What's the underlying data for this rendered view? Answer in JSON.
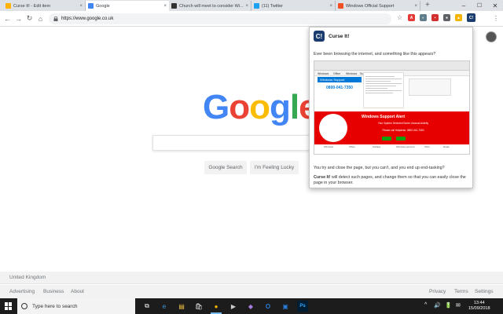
{
  "tabs": [
    {
      "title": "Curse It! - Edit item",
      "favicon_color": "#ffb300"
    },
    {
      "title": "Google",
      "favicon_color": "#4285f4",
      "active": true
    },
    {
      "title": "Church will meet to consider Wi...",
      "favicon_color": "#333333"
    },
    {
      "title": "(11) Twitter",
      "favicon_color": "#1da1f2"
    },
    {
      "title": "Windows Official Support",
      "favicon_color": "#f25022"
    }
  ],
  "tab_close_glyph": "×",
  "new_tab_glyph": "+",
  "window_controls": {
    "minimize": "–",
    "maximize": "☐",
    "close": "✕"
  },
  "toolbar": {
    "back": "←",
    "forward": "→",
    "reload": "↻",
    "home": "⌂",
    "url": "https://www.google.co.uk",
    "star": "☆",
    "extensions": [
      {
        "label": "A",
        "color": "#e53935"
      },
      {
        "label": "◐",
        "color": "#607d8b"
      },
      {
        "label": "▪",
        "color": "#d32f2f"
      },
      {
        "label": "●",
        "color": "#5f6368"
      },
      {
        "label": "▲",
        "color": "#f4b400"
      },
      {
        "label": "C!",
        "color": "#1a3c6e"
      }
    ],
    "menu": "⋮"
  },
  "google": {
    "logo_letters": [
      {
        "ch": "G",
        "color": "#4285f4"
      },
      {
        "ch": "o",
        "color": "#ea4335"
      },
      {
        "ch": "o",
        "color": "#fbbc05"
      },
      {
        "ch": "g",
        "color": "#4285f4"
      },
      {
        "ch": "l",
        "color": "#34a853"
      },
      {
        "ch": "e",
        "color": "#ea4335"
      }
    ],
    "search_button": "Google Search",
    "lucky_button": "I'm Feeling Lucky",
    "country": "United Kingdom",
    "footer_left": [
      "Advertising",
      "Business",
      "About"
    ],
    "footer_right": [
      "Privacy",
      "Terms",
      "Settings"
    ]
  },
  "popup": {
    "badge": "C!",
    "title": "Curse It!",
    "intro": "Ever been browsing the internet, and something like this appears?",
    "para1": "You try and close the page, but you can't, and you end up end-tasking?",
    "para2_bold": "Curse It!",
    "para2_rest": " will detect such pages, and change them so that you can easily close the page in your browser.",
    "shot": {
      "nav_items": [
        "Windows",
        "Office",
        "Windows",
        "Surface",
        "Xbox",
        "Deals"
      ],
      "bar_label": "Windows Support",
      "phone": "0800-041-7350",
      "alert_title": "Windows Support Alert",
      "alert_sub1": "Your System Detected Some Unusual Activity",
      "alert_sub2": "Please call Helpdesk: 0800-041-7350",
      "footer_items": [
        "Windows",
        "Office",
        "Surface",
        "Windows account",
        "Xbox",
        "Deals"
      ]
    }
  },
  "taskbar": {
    "search_placeholder": "Type here to search",
    "apps": [
      "⧉",
      "e",
      "▤",
      "🛍",
      "●",
      "▶",
      "◆",
      "O",
      "▣",
      "Ps"
    ],
    "tray": [
      "^",
      "🔊",
      "🔋",
      "✉"
    ],
    "time": "13:44",
    "date": "15/09/2018"
  }
}
